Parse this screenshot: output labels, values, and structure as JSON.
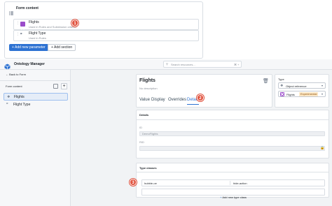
{
  "form_panel": {
    "title": "Form content",
    "params": [
      {
        "name": "Flights",
        "desc": "Used in Rules and Submission criteria"
      },
      {
        "name": "Flight Type",
        "desc": "Used in Rules"
      }
    ],
    "add_param_label": "Add new parameter",
    "add_section_label": "Add section",
    "badge": "1"
  },
  "app_bar": {
    "title": "Ontology Manager",
    "search_placeholder": "Search resources...",
    "shortcut": "⌘ + "
  },
  "sidebar": {
    "back_label": "Back to Form",
    "section_title": "Form content",
    "items": [
      {
        "label": "Flights",
        "selected": true
      },
      {
        "label": "Flight Type",
        "selected": false
      }
    ]
  },
  "detail": {
    "title": "Flights",
    "description": "No description",
    "tabs": [
      "Value",
      "Display",
      "Overrides",
      "Details"
    ],
    "active_tab": "Details",
    "badge_tab": "2",
    "type_label": "Type",
    "type_value": "Object reference",
    "object_label": "Flights",
    "object_tag": "Experimental",
    "details_header": "Details",
    "id_label": "ID",
    "id_value": "DemoFlights",
    "rid_label": "RID",
    "type_classes_header": "Type classes",
    "type_class": {
      "kind": "hubble-oe",
      "value": "hide-action"
    },
    "add_type_class_label": "Add new type class",
    "badge_classes": "3"
  },
  "colors": {
    "accent": "#2d72d2",
    "badge": "#e0513d",
    "tag": "#d99e0b"
  }
}
